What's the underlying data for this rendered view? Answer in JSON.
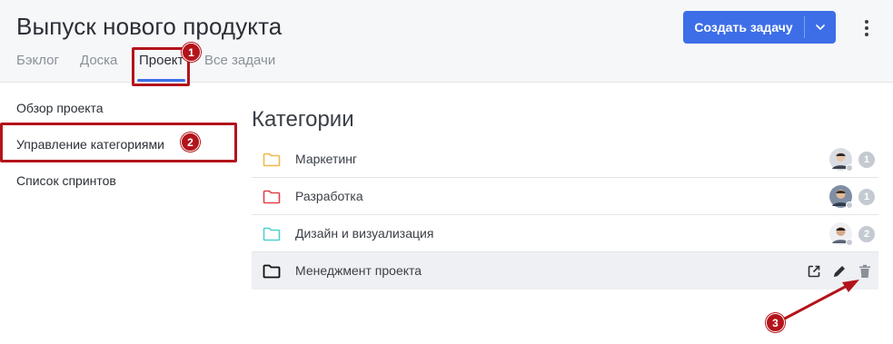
{
  "header": {
    "title": "Выпуск нового продукта",
    "tabs": [
      {
        "label": "Бэклог",
        "active": false
      },
      {
        "label": "Доска",
        "active": false
      },
      {
        "label": "Проект",
        "active": true
      },
      {
        "label": "Все задачи",
        "active": false
      }
    ],
    "create_button_label": "Создать задачу",
    "accent_color": "#3d6ee8"
  },
  "sidebar": {
    "items": [
      {
        "label": "Обзор проекта"
      },
      {
        "label": "Управление категориями"
      },
      {
        "label": "Список спринтов"
      }
    ]
  },
  "main": {
    "title": "Категории",
    "categories": [
      {
        "name": "Маркетинг",
        "folder_color": "#f0b84a",
        "count": "1",
        "icon": "folder-icon"
      },
      {
        "name": "Разработка",
        "folder_color": "#e2434b",
        "count": "1",
        "icon": "folder-icon"
      },
      {
        "name": "Дизайн и визуализация",
        "folder_color": "#4fd0cf",
        "count": "2",
        "icon": "folder-icon"
      },
      {
        "name": "Менеджмент проекта",
        "folder_color": "#111111",
        "icon": "folder-icon",
        "actions": [
          "open-external-icon",
          "edit-pencil-icon",
          "delete-trash-icon"
        ]
      }
    ]
  },
  "annotations": {
    "color": "#b3141b",
    "markers": [
      "1",
      "2",
      "3"
    ]
  }
}
